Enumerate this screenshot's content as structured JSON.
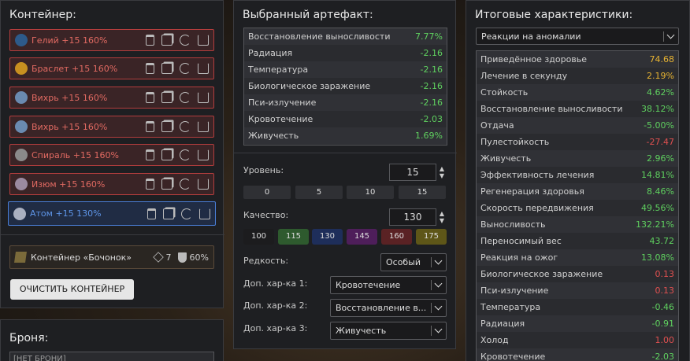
{
  "container": {
    "title": "Контейнер:",
    "items": [
      {
        "name": "Гелий +15 160%",
        "icon": "helium-icon",
        "color": "#2d5a8a"
      },
      {
        "name": "Браслет +15 160%",
        "icon": "bracelet-icon",
        "color": "#c89020"
      },
      {
        "name": "Вихрь +15 160%",
        "icon": "whirl-icon",
        "color": "#6a8ab0"
      },
      {
        "name": "Вихрь +15 160%",
        "icon": "whirl-icon",
        "color": "#6a8ab0"
      },
      {
        "name": "Спираль +15 160%",
        "icon": "spiral-icon",
        "color": "#8a8a8a"
      },
      {
        "name": "Изюм +15 160%",
        "icon": "raisin-icon",
        "color": "#9a8aa0"
      },
      {
        "name": "Атом +15 130%",
        "icon": "atom-icon",
        "color": "#aab0c0"
      }
    ],
    "barrel": {
      "name": "Контейнер «Бочонок»",
      "slots": "7",
      "protection": "60%"
    },
    "clear_button": "ОЧИСТИТЬ КОНТЕЙНЕР"
  },
  "armor": {
    "title": "Броня:",
    "value": "[НЕТ БРОНИ]"
  },
  "artifact": {
    "title": "Выбранный артефакт:",
    "stats": [
      {
        "label": "Восстановление выносливости",
        "value": "7.77%",
        "tone": "pos"
      },
      {
        "label": "Радиация",
        "value": "-2.16",
        "tone": "pos"
      },
      {
        "label": "Температура",
        "value": "-2.16",
        "tone": "pos"
      },
      {
        "label": "Биологическое заражение",
        "value": "-2.16",
        "tone": "pos"
      },
      {
        "label": "Пси-излучение",
        "value": "-2.16",
        "tone": "pos"
      },
      {
        "label": "Кровотечение",
        "value": "-2.03",
        "tone": "pos"
      },
      {
        "label": "Живучесть",
        "value": "1.69%",
        "tone": "pos"
      }
    ],
    "level_label": "Уровень:",
    "level_value": "15",
    "level_presets": [
      "0",
      "5",
      "10",
      "15"
    ],
    "quality_label": "Качество:",
    "quality_value": "130",
    "quality_presets": [
      {
        "v": "100",
        "c": "#1c1c1e"
      },
      {
        "v": "115",
        "c": "#2e5a2e"
      },
      {
        "v": "130",
        "c": "#1e2e5a"
      },
      {
        "v": "145",
        "c": "#4e1e5a"
      },
      {
        "v": "160",
        "c": "#5a2224"
      },
      {
        "v": "175",
        "c": "#5e5618"
      }
    ],
    "rarity_label": "Редкость:",
    "rarity_value": "Особый",
    "extra1_label": "Доп. хар-ка 1:",
    "extra1_value": "Кровотечение",
    "extra2_label": "Доп. хар-ка 2:",
    "extra2_value": "Восстановление в...",
    "extra3_label": "Доп. хар-ка 3:",
    "extra3_value": "Живучесть"
  },
  "totals": {
    "title": "Итоговые характеристики:",
    "filter": "Реакции на аномалии",
    "stats": [
      {
        "label": "Приведённое здоровье",
        "value": "74.68",
        "tone": "yel"
      },
      {
        "label": "Лечение в секунду",
        "value": "2.19%",
        "tone": "yel"
      },
      {
        "label": "Стойкость",
        "value": "4.62%",
        "tone": "pos"
      },
      {
        "label": "Восстановление выносливости",
        "value": "38.12%",
        "tone": "pos"
      },
      {
        "label": "Отдача",
        "value": "-5.00%",
        "tone": "pos"
      },
      {
        "label": "Пулестойкость",
        "value": "-27.47",
        "tone": "neg"
      },
      {
        "label": "Живучесть",
        "value": "2.96%",
        "tone": "pos"
      },
      {
        "label": "Эффективность лечения",
        "value": "14.81%",
        "tone": "pos"
      },
      {
        "label": "Регенерация здоровья",
        "value": "8.46%",
        "tone": "pos"
      },
      {
        "label": "Скорость передвижения",
        "value": "49.56%",
        "tone": "pos"
      },
      {
        "label": "Выносливость",
        "value": "132.21%",
        "tone": "pos"
      },
      {
        "label": "Переносимый вес",
        "value": "43.72",
        "tone": "pos"
      },
      {
        "label": "Реакция на ожог",
        "value": "13.08%",
        "tone": "pos"
      },
      {
        "label": "Биологическое заражение",
        "value": "0.13",
        "tone": "neg"
      },
      {
        "label": "Пси-излучение",
        "value": "0.13",
        "tone": "neg"
      },
      {
        "label": "Температура",
        "value": "-0.46",
        "tone": "pos"
      },
      {
        "label": "Радиация",
        "value": "-0.91",
        "tone": "pos"
      },
      {
        "label": "Холод",
        "value": "1.00",
        "tone": "neg"
      },
      {
        "label": "Кровотечение",
        "value": "-2.03",
        "tone": "pos"
      }
    ]
  }
}
